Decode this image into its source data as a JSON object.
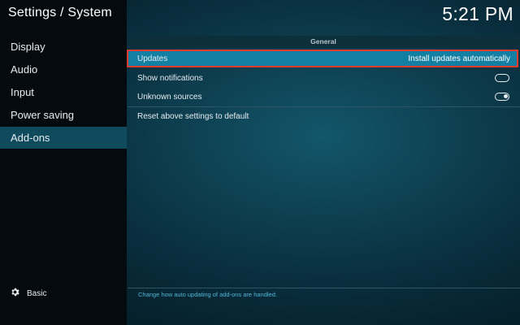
{
  "header": {
    "title": "Settings / System",
    "time": "5:21 PM"
  },
  "sidebar": {
    "items": [
      {
        "label": "Display"
      },
      {
        "label": "Audio"
      },
      {
        "label": "Input"
      },
      {
        "label": "Power saving"
      },
      {
        "label": "Add-ons"
      }
    ],
    "selected": "Add-ons",
    "footer": {
      "label": "Basic",
      "icon": "gear-icon"
    }
  },
  "main": {
    "section_title": "General",
    "settings": {
      "updates": {
        "label": "Updates",
        "value": "Install updates automatically"
      },
      "show_notifications": {
        "label": "Show notifications",
        "enabled": false
      },
      "unknown_sources": {
        "label": "Unknown sources",
        "enabled": true
      },
      "reset": {
        "label": "Reset above settings to default"
      }
    },
    "hint": "Change how auto updating of add-ons are handled."
  },
  "colors": {
    "accent": "#137fa3",
    "focus_outline": "#e03a2e",
    "sidebar_selected": "#0f4a5d",
    "hint_text": "#4fb6d8"
  }
}
